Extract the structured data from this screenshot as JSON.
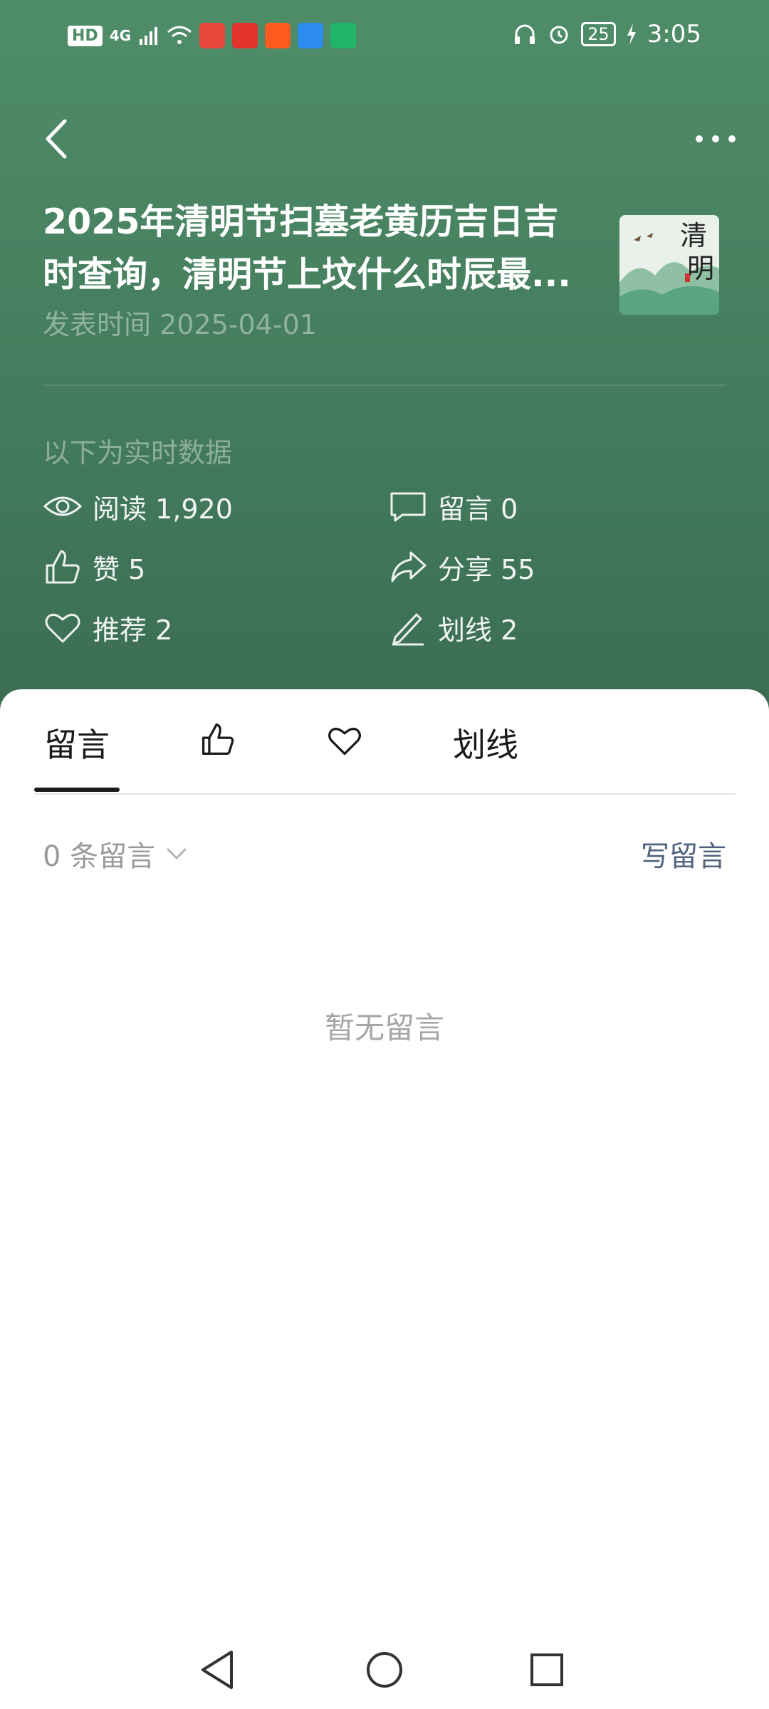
{
  "status_bar": {
    "hd": "HD",
    "signal": "4G",
    "battery": "25",
    "time": "3:05"
  },
  "article": {
    "title": "2025年清明节扫墓老黄历吉日吉时查询，清明节上坟什么时辰最...",
    "publish_time": "发表时间 2025-04-01",
    "thumb_text_1": "清",
    "thumb_text_2": "明"
  },
  "realtime_label": "以下为实时数据",
  "stats": {
    "read": "阅读 1,920",
    "comment": "留言 0",
    "like": "赞 5",
    "share": "分享 55",
    "recommend": "推荐 2",
    "underline": "划线 2"
  },
  "tabs": {
    "comments": "留言",
    "underline": "划线"
  },
  "comments": {
    "count_label": "0 条留言",
    "write_label": "写留言",
    "empty_text": "暂无留言"
  },
  "colors": {
    "hero_bg": "#4f8d69",
    "write_link": "#51647f"
  }
}
